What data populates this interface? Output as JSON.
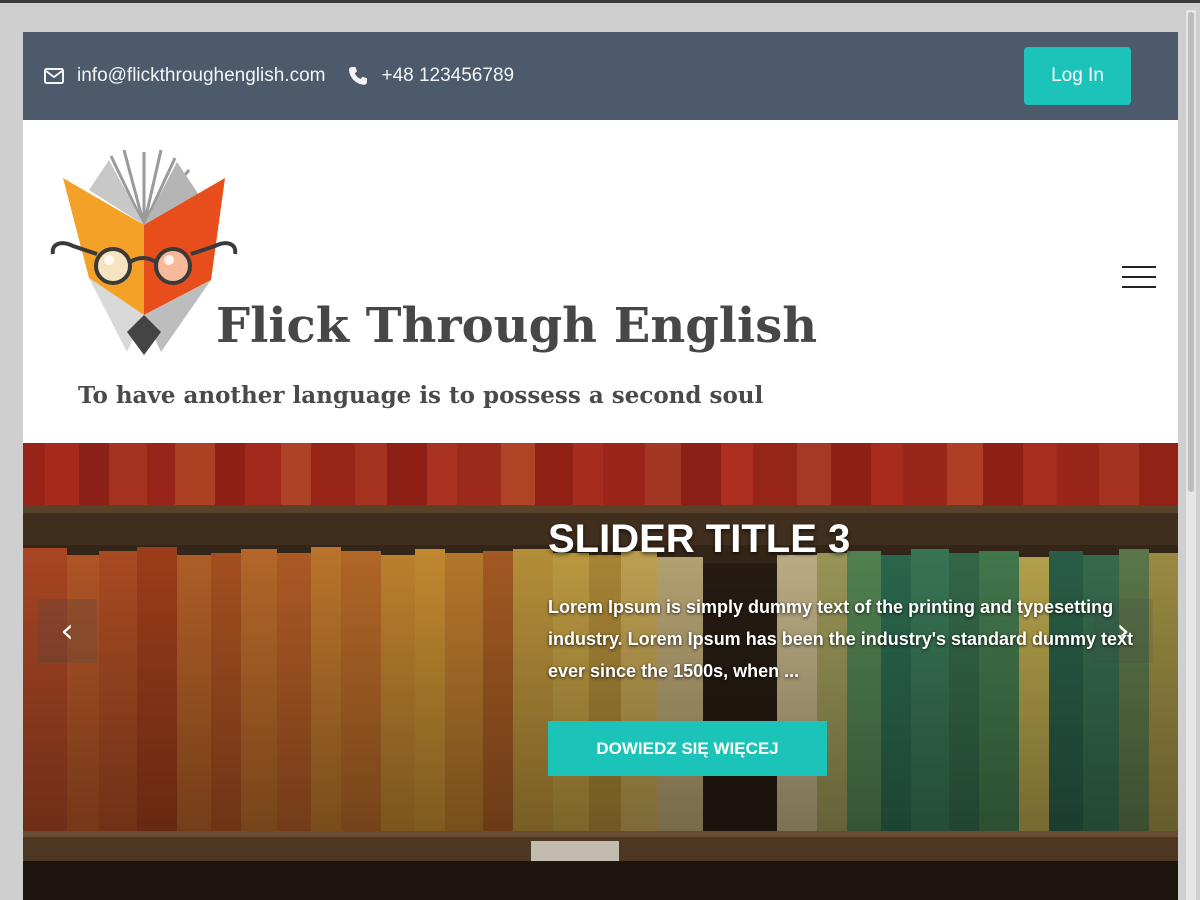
{
  "contact": {
    "email": "info@flickthroughenglish.com",
    "email_icon": "envelope-icon",
    "phone": "+48 123456789",
    "phone_icon": "phone-icon"
  },
  "auth": {
    "login_label": "Log In"
  },
  "branding": {
    "title": "Flick Through English",
    "tagline": "To have another language is to possess a second soul"
  },
  "nav": {
    "menu_icon": "hamburger-menu-icon"
  },
  "slider": {
    "title": "SLIDER TITLE 3",
    "text": "Lorem Ipsum is simply dummy text of the printing and typesetting industry. Lorem Ipsum has been the industry's standard dummy text ever since the 1500s, when ...",
    "cta_label": "DOWIEDZ SIĘ WIĘCEJ",
    "prev_icon": "chevron-left-icon",
    "next_icon": "chevron-right-icon"
  },
  "colors": {
    "contact_bar": "#4c5a6b",
    "accent": "#1cc3b9",
    "title_text": "#474747"
  }
}
